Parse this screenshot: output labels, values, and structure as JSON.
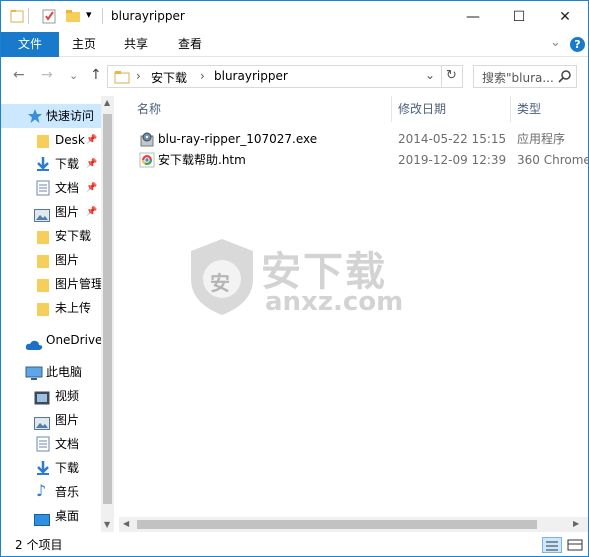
{
  "window": {
    "title": "blurayripper"
  },
  "controls": {
    "minimize": "—",
    "maximize": "☐",
    "close": "✕",
    "qa_dropdown": "▾"
  },
  "ribbon": {
    "tabs": [
      {
        "label": "文件"
      },
      {
        "label": "主页"
      },
      {
        "label": "共享"
      },
      {
        "label": "查看"
      }
    ],
    "expand": "⌄",
    "help": "?"
  },
  "nav": {
    "back": "←",
    "forward": "→",
    "recent": "⌄",
    "up": "↑",
    "sep": "›",
    "dropdown": "⌄",
    "refresh": "↻"
  },
  "address": {
    "segments": [
      "安下载",
      "blurayripper"
    ]
  },
  "search": {
    "placeholder": "搜索\"blura..."
  },
  "sidebar": {
    "quick_access": "快速访问",
    "items": [
      {
        "label": "Desk",
        "icon": "folder-icon",
        "pinned": true
      },
      {
        "label": "下载",
        "icon": "download-icon",
        "pinned": true
      },
      {
        "label": "文档",
        "icon": "document-icon",
        "pinned": true
      },
      {
        "label": "图片",
        "icon": "picture-icon",
        "pinned": true
      },
      {
        "label": "安下载",
        "icon": "folder-icon",
        "pinned": false
      },
      {
        "label": "图片",
        "icon": "folder-icon",
        "pinned": false
      },
      {
        "label": "图片管理",
        "icon": "folder-icon",
        "pinned": false
      },
      {
        "label": "未上传",
        "icon": "folder-icon",
        "pinned": false
      }
    ],
    "onedrive": "OneDrive",
    "this_pc": "此电脑",
    "pc_items": [
      {
        "label": "视频",
        "icon": "video-icon"
      },
      {
        "label": "图片",
        "icon": "picture-icon"
      },
      {
        "label": "文档",
        "icon": "document-icon"
      },
      {
        "label": "下载",
        "icon": "download-icon"
      },
      {
        "label": "音乐",
        "icon": "music-icon"
      },
      {
        "label": "桌面",
        "icon": "desktop-icon"
      }
    ]
  },
  "columns": {
    "name": "名称",
    "date": "修改日期",
    "type": "类型",
    "sort_indicator": "^"
  },
  "files": [
    {
      "name": "blu-ray-ripper_107027.exe",
      "date": "2014-05-22 15:15",
      "type": "应用程序",
      "icon": "exe-icon"
    },
    {
      "name": "安下载帮助.htm",
      "date": "2019-12-09 12:39",
      "type": "360 Chrome",
      "icon": "chrome-html-icon"
    }
  ],
  "watermark": {
    "cn": "安下载",
    "en": "anxz.com",
    "badge": "安"
  },
  "status": {
    "count": "2 个项目"
  },
  "colors": {
    "accent": "#1979ca",
    "folder": "#f6cf5a",
    "selected_bg": "#cce8ff"
  }
}
